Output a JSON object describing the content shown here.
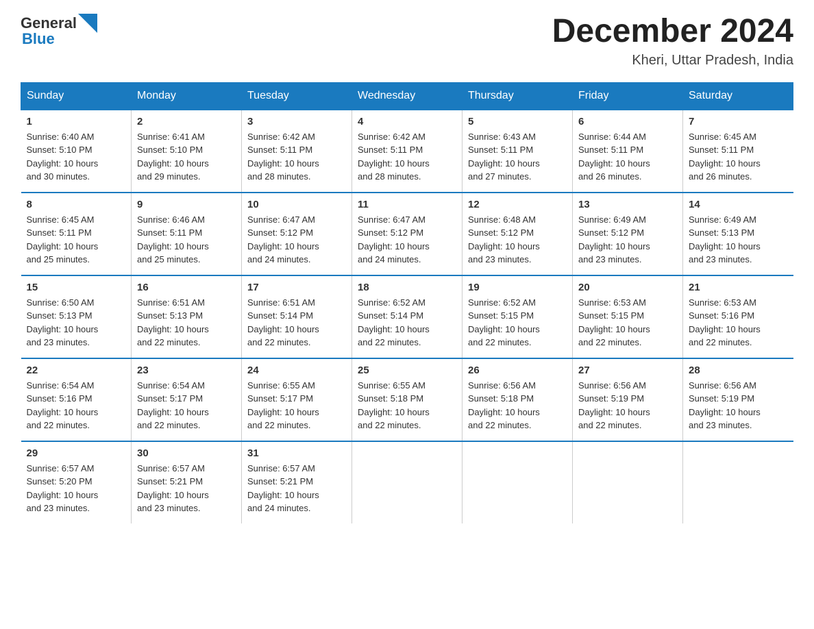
{
  "logo": {
    "text_general": "General",
    "text_blue": "Blue",
    "arrow_color": "#1a7abf"
  },
  "header": {
    "month_year": "December 2024",
    "location": "Kheri, Uttar Pradesh, India"
  },
  "days_of_week": [
    "Sunday",
    "Monday",
    "Tuesday",
    "Wednesday",
    "Thursday",
    "Friday",
    "Saturday"
  ],
  "weeks": [
    [
      {
        "day": "1",
        "info": "Sunrise: 6:40 AM\nSunset: 5:10 PM\nDaylight: 10 hours\nand 30 minutes."
      },
      {
        "day": "2",
        "info": "Sunrise: 6:41 AM\nSunset: 5:10 PM\nDaylight: 10 hours\nand 29 minutes."
      },
      {
        "day": "3",
        "info": "Sunrise: 6:42 AM\nSunset: 5:11 PM\nDaylight: 10 hours\nand 28 minutes."
      },
      {
        "day": "4",
        "info": "Sunrise: 6:42 AM\nSunset: 5:11 PM\nDaylight: 10 hours\nand 28 minutes."
      },
      {
        "day": "5",
        "info": "Sunrise: 6:43 AM\nSunset: 5:11 PM\nDaylight: 10 hours\nand 27 minutes."
      },
      {
        "day": "6",
        "info": "Sunrise: 6:44 AM\nSunset: 5:11 PM\nDaylight: 10 hours\nand 26 minutes."
      },
      {
        "day": "7",
        "info": "Sunrise: 6:45 AM\nSunset: 5:11 PM\nDaylight: 10 hours\nand 26 minutes."
      }
    ],
    [
      {
        "day": "8",
        "info": "Sunrise: 6:45 AM\nSunset: 5:11 PM\nDaylight: 10 hours\nand 25 minutes."
      },
      {
        "day": "9",
        "info": "Sunrise: 6:46 AM\nSunset: 5:11 PM\nDaylight: 10 hours\nand 25 minutes."
      },
      {
        "day": "10",
        "info": "Sunrise: 6:47 AM\nSunset: 5:12 PM\nDaylight: 10 hours\nand 24 minutes."
      },
      {
        "day": "11",
        "info": "Sunrise: 6:47 AM\nSunset: 5:12 PM\nDaylight: 10 hours\nand 24 minutes."
      },
      {
        "day": "12",
        "info": "Sunrise: 6:48 AM\nSunset: 5:12 PM\nDaylight: 10 hours\nand 23 minutes."
      },
      {
        "day": "13",
        "info": "Sunrise: 6:49 AM\nSunset: 5:12 PM\nDaylight: 10 hours\nand 23 minutes."
      },
      {
        "day": "14",
        "info": "Sunrise: 6:49 AM\nSunset: 5:13 PM\nDaylight: 10 hours\nand 23 minutes."
      }
    ],
    [
      {
        "day": "15",
        "info": "Sunrise: 6:50 AM\nSunset: 5:13 PM\nDaylight: 10 hours\nand 23 minutes."
      },
      {
        "day": "16",
        "info": "Sunrise: 6:51 AM\nSunset: 5:13 PM\nDaylight: 10 hours\nand 22 minutes."
      },
      {
        "day": "17",
        "info": "Sunrise: 6:51 AM\nSunset: 5:14 PM\nDaylight: 10 hours\nand 22 minutes."
      },
      {
        "day": "18",
        "info": "Sunrise: 6:52 AM\nSunset: 5:14 PM\nDaylight: 10 hours\nand 22 minutes."
      },
      {
        "day": "19",
        "info": "Sunrise: 6:52 AM\nSunset: 5:15 PM\nDaylight: 10 hours\nand 22 minutes."
      },
      {
        "day": "20",
        "info": "Sunrise: 6:53 AM\nSunset: 5:15 PM\nDaylight: 10 hours\nand 22 minutes."
      },
      {
        "day": "21",
        "info": "Sunrise: 6:53 AM\nSunset: 5:16 PM\nDaylight: 10 hours\nand 22 minutes."
      }
    ],
    [
      {
        "day": "22",
        "info": "Sunrise: 6:54 AM\nSunset: 5:16 PM\nDaylight: 10 hours\nand 22 minutes."
      },
      {
        "day": "23",
        "info": "Sunrise: 6:54 AM\nSunset: 5:17 PM\nDaylight: 10 hours\nand 22 minutes."
      },
      {
        "day": "24",
        "info": "Sunrise: 6:55 AM\nSunset: 5:17 PM\nDaylight: 10 hours\nand 22 minutes."
      },
      {
        "day": "25",
        "info": "Sunrise: 6:55 AM\nSunset: 5:18 PM\nDaylight: 10 hours\nand 22 minutes."
      },
      {
        "day": "26",
        "info": "Sunrise: 6:56 AM\nSunset: 5:18 PM\nDaylight: 10 hours\nand 22 minutes."
      },
      {
        "day": "27",
        "info": "Sunrise: 6:56 AM\nSunset: 5:19 PM\nDaylight: 10 hours\nand 22 minutes."
      },
      {
        "day": "28",
        "info": "Sunrise: 6:56 AM\nSunset: 5:19 PM\nDaylight: 10 hours\nand 23 minutes."
      }
    ],
    [
      {
        "day": "29",
        "info": "Sunrise: 6:57 AM\nSunset: 5:20 PM\nDaylight: 10 hours\nand 23 minutes."
      },
      {
        "day": "30",
        "info": "Sunrise: 6:57 AM\nSunset: 5:21 PM\nDaylight: 10 hours\nand 23 minutes."
      },
      {
        "day": "31",
        "info": "Sunrise: 6:57 AM\nSunset: 5:21 PM\nDaylight: 10 hours\nand 24 minutes."
      },
      {
        "day": "",
        "info": ""
      },
      {
        "day": "",
        "info": ""
      },
      {
        "day": "",
        "info": ""
      },
      {
        "day": "",
        "info": ""
      }
    ]
  ]
}
